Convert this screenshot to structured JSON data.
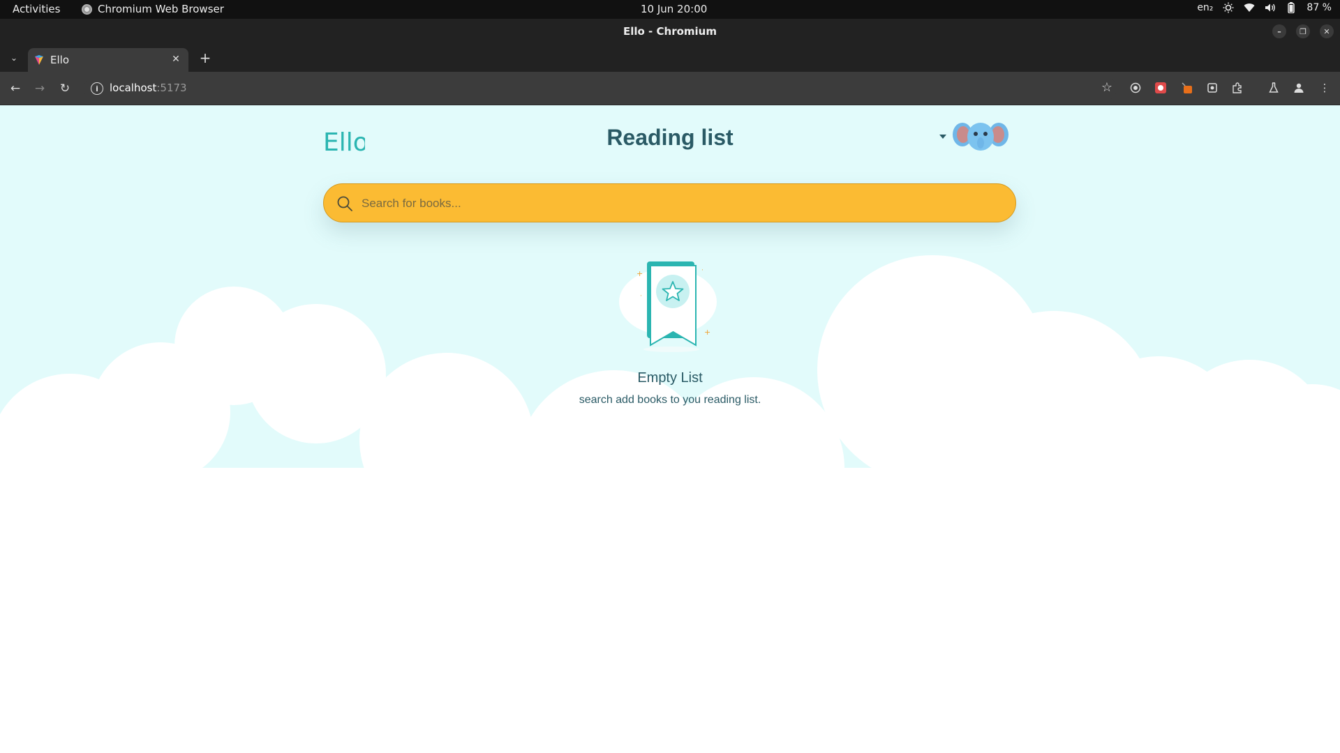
{
  "os": {
    "activities": "Activities",
    "app_name": "Chromium Web Browser",
    "clock": "10 Jun  20:00",
    "lang": "en₂",
    "battery": "87 %"
  },
  "window": {
    "title": "Ello - Chromium"
  },
  "tabs": [
    {
      "title": "Ello"
    }
  ],
  "toolbar": {
    "url_host": "localhost",
    "url_port": ":5173"
  },
  "page": {
    "logo_text": "Ello",
    "title": "Reading list",
    "search_placeholder": "Search for books...",
    "empty_title": "Empty List",
    "empty_subtitle": "search add books to you reading list."
  },
  "colors": {
    "page_bg": "#e2fbfb",
    "accent_teal": "#2bb5b1",
    "search_yellow": "#fbbb33",
    "title_text": "#2a5a65"
  }
}
